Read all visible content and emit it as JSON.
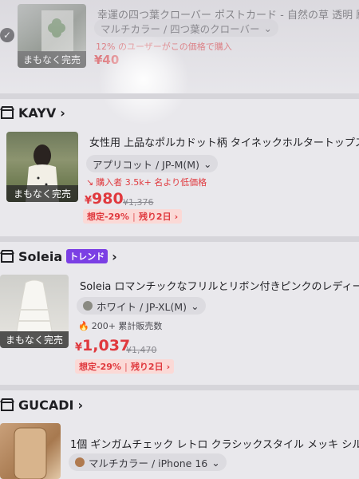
{
  "products_top": {
    "title": "幸運の四つ葉クローバー ポストカード - 自然の草 透明 願い事",
    "variant": "マルチカラー / 四つ葉のクローバー",
    "note": "12% のユーザーがこの価格で購入",
    "soon": "まもなく完売",
    "price_partial": "¥40"
  },
  "stores": [
    {
      "name": "KAYV",
      "product": {
        "title": "女性用 上品なポルカドット柄 タイネックホルタートップス 夏",
        "variant": "アプリコット / JP-M(M)",
        "note": "購入者 3.5k+ 名より低価格",
        "soon": "まもなく完売",
        "price_symbol": "¥",
        "price": "980",
        "original_price": "¥1,376",
        "discount": "想定-29%",
        "remaining": "残り2日"
      }
    },
    {
      "name": "Soleia",
      "badge": "トレンド",
      "product": {
        "title": "Soleia ロマンチックなフリルとリボン付きピンクのレディース",
        "variant": "ホワイト / JP-XL(M)",
        "note": "200+ 累計販売数",
        "soon": "まもなく完売",
        "price_symbol": "¥",
        "price": "1,037",
        "original_price": "¥1,470",
        "discount": "想定-29%",
        "remaining": "残り2日"
      }
    },
    {
      "name": "GUCADI",
      "product": {
        "title": "1個 ギンガムチェック レトロ クラシックスタイル メッキ シル",
        "variant": "マルチカラー / iPhone 16"
      }
    }
  ],
  "colors": {
    "accent_red": "#e0393e",
    "trend_purple": "#7b3fe4",
    "promo_bg": "#fbd9d6"
  }
}
